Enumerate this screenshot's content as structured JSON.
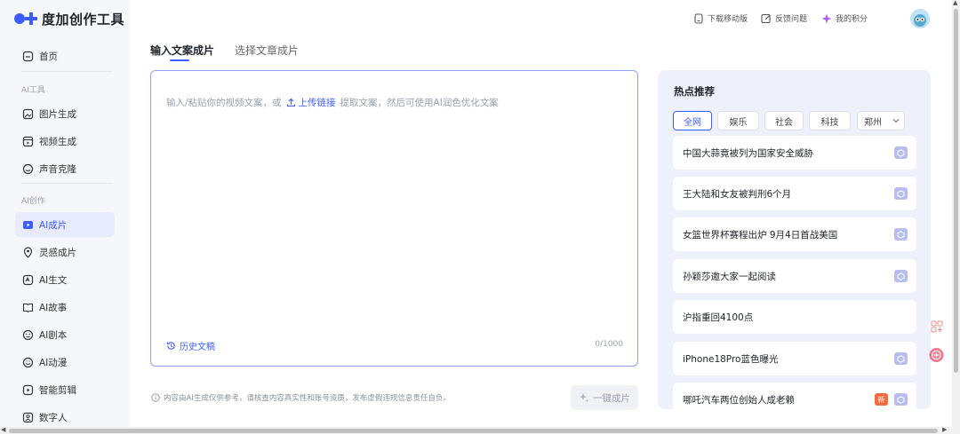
{
  "app": {
    "name": "度加创作工具"
  },
  "sidebar": {
    "home": "首页",
    "group_tools": "AI工具",
    "tools": [
      "图片生成",
      "视频生成",
      "声音克隆"
    ],
    "group_create": "AI创作",
    "create": [
      "AI成片",
      "灵感成片",
      "AI生文",
      "AI故事",
      "AI剧本",
      "AI动漫",
      "智能剪辑",
      "数字人"
    ],
    "active": "AI成片"
  },
  "topbar": {
    "download": "下载移动版",
    "feedback": "反馈问题",
    "points": "我的积分"
  },
  "tabs": [
    "输入文案成片",
    "选择文章成片"
  ],
  "editor": {
    "placeholder_before": "输入/粘贴你的视频文案，或",
    "upload_link": "上传链接",
    "placeholder_after": "提取文案，然后可使用AI润色优化文案",
    "history": "历史文稿",
    "counter": "0/1000"
  },
  "disclaimer": "内容由AI生成仅供参考，请核查内容真实性和账号资质，发布虚假违规信息责任自负。",
  "generate_button": "一键成片",
  "hot": {
    "title": "热点推荐",
    "chips": [
      "全网",
      "娱乐",
      "社会",
      "科技",
      "郑州"
    ],
    "active_chip": "全网",
    "items": [
      {
        "text": "中国大蒜竟被列为国家安全威胁",
        "cube": true,
        "new": false
      },
      {
        "text": "王大陆和女友被判刑6个月",
        "cube": true,
        "new": false
      },
      {
        "text": "女篮世界杯赛程出炉 9月4日首战美国",
        "cube": true,
        "new": false
      },
      {
        "text": "孙颖莎邀大家一起阅读",
        "cube": true,
        "new": false
      },
      {
        "text": "沪指重回4100点",
        "cube": false,
        "new": false
      },
      {
        "text": "iPhone18Pro蓝色曝光",
        "cube": true,
        "new": false
      },
      {
        "text": "哪吒汽车两位创始人成老赖",
        "cube": true,
        "new": true
      }
    ],
    "new_badge": "新"
  },
  "colors": {
    "accent": "#3b5cff",
    "sidebar_bg": "#f6f7fb",
    "hot_bg": "#eef0fb"
  }
}
